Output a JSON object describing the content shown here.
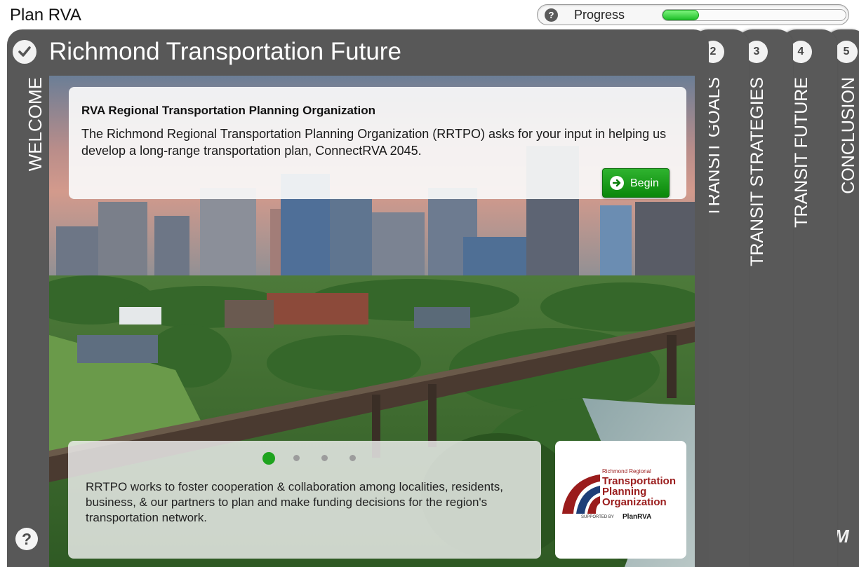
{
  "app": {
    "title": "Plan RVA"
  },
  "progress": {
    "label": "Progress",
    "help_icon": "question-icon",
    "fraction": 0.2
  },
  "main": {
    "title": "Richmond Transportation Future",
    "side_label": "WELCOME",
    "check_icon": "check-icon",
    "help_icon": "question-icon"
  },
  "info_card": {
    "title": "RVA Regional Transportation Planning Organization",
    "body": "The Richmond Regional Transportation Planning Organization (RRTPO) asks for your input in helping us develop a long-range transportation plan, ConnectRVA 2045.",
    "begin_label": "Begin",
    "begin_icon": "arrow-right-circle-icon",
    "accent": "#1a9c1a"
  },
  "carousel": {
    "active_index": 0,
    "dot_count": 4,
    "text": "RRTPO works to foster cooperation & collaboration among localities, residents, business, & our partners to plan and make funding decisions for the region's transportation network."
  },
  "logo": {
    "line1": "Richmond Regional",
    "line2": "Transportation",
    "line3": "Planning",
    "line4": "Organization",
    "supported": "SUPPORTED BY",
    "brand": "PlanRVA"
  },
  "tabs": [
    {
      "number": "2",
      "label": "TRANSIT GOALS"
    },
    {
      "number": "3",
      "label": "TRANSIT STRATEGIES"
    },
    {
      "number": "4",
      "label": "TRANSIT FUTURE"
    },
    {
      "number": "5",
      "label": "CONCLUSION"
    }
  ],
  "corner_logo": "M"
}
